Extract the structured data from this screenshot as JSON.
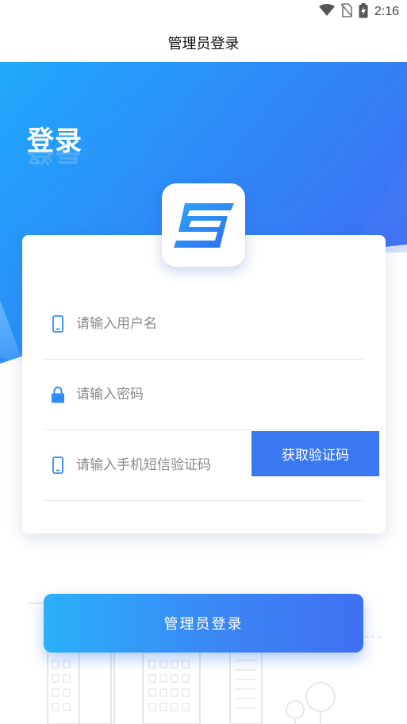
{
  "status_bar": {
    "time": "2:16",
    "icons": [
      "wifi-icon",
      "no-sim-icon",
      "battery-charging-icon"
    ]
  },
  "header": {
    "title": "管理员登录"
  },
  "hero": {
    "title": "登录",
    "colors": {
      "gradient_start": "#1fa8fb",
      "gradient_end": "#3c6ff3"
    }
  },
  "logo": {
    "icon": "app-logo-icon",
    "color": "#2f8df3"
  },
  "form": {
    "username": {
      "placeholder": "请输入用户名",
      "value": "",
      "icon": "phone-icon"
    },
    "password": {
      "placeholder": "请输入密码",
      "value": "",
      "icon": "lock-icon"
    },
    "sms_code": {
      "placeholder": "请输入手机短信验证码",
      "value": "",
      "icon": "phone-icon"
    },
    "get_code_label": "获取验证码"
  },
  "login_button": {
    "label": "管理员登录"
  },
  "colors": {
    "accent": "#3a78f2",
    "icon_blue": "#2f8df3",
    "placeholder": "#8a8a8a"
  }
}
